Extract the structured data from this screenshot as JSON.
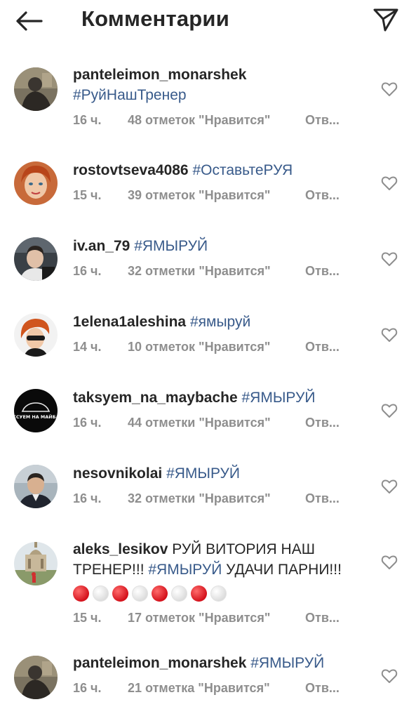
{
  "header": {
    "title": "Комментарии",
    "back_icon": "arrow-left-icon",
    "send_icon": "paper-plane-icon"
  },
  "colors": {
    "hashtag": "#385a8a",
    "meta": "#8e8e8e",
    "text": "#262626"
  },
  "comments": [
    {
      "username": "panteleimon_monarshek",
      "text": "",
      "hashtag": "#РуйНашТренер",
      "time": "16 ч.",
      "likes": "48 отметок \"Нравится\"",
      "reply": "Отв..."
    },
    {
      "username": "rostovtseva4086",
      "text": "",
      "hashtag": "#ОставьтеРУЯ",
      "time": "15 ч.",
      "likes": "39 отметок \"Нравится\"",
      "reply": "Отв..."
    },
    {
      "username": "iv.an_79",
      "text": "",
      "hashtag": "#ЯМЫРУЙ",
      "time": "16 ч.",
      "likes": "32 отметки \"Нравится\"",
      "reply": "Отв..."
    },
    {
      "username": "1elena1aleshina",
      "text": "",
      "hashtag": "#ямыруй",
      "time": "14 ч.",
      "likes": "10 отметок \"Нравится\"",
      "reply": "Отв..."
    },
    {
      "username": "taksyem_na_maybache",
      "text": "",
      "hashtag": "#ЯМЫРУЙ",
      "time": "16 ч.",
      "likes": "44 отметки \"Нравится\"",
      "reply": "Отв...",
      "avatar_text": "ТАКСУЕМ НА МАЙБАХЕ"
    },
    {
      "username": "nesovnikolai",
      "text": "",
      "hashtag": "#ЯМЫРУЙ",
      "time": "16 ч.",
      "likes": "32 отметки \"Нравится\"",
      "reply": "Отв..."
    },
    {
      "username": "aleks_lesikov",
      "text_before": "РУЙ ВИТОРИЯ НАШ ТРЕНЕР!!!",
      "hashtag": "#ЯМЫРУЙ",
      "text_after": "УДАЧИ ПАРНИ!!!",
      "time": "15 ч.",
      "likes": "17 отметок \"Нравится\"",
      "reply": "Отв..."
    },
    {
      "username": "panteleimon_monarshek",
      "text": "",
      "hashtag": "#ЯМЫРУЙ",
      "time": "16 ч.",
      "likes": "21 отметка \"Нравится\"",
      "reply": "Отв..."
    }
  ]
}
